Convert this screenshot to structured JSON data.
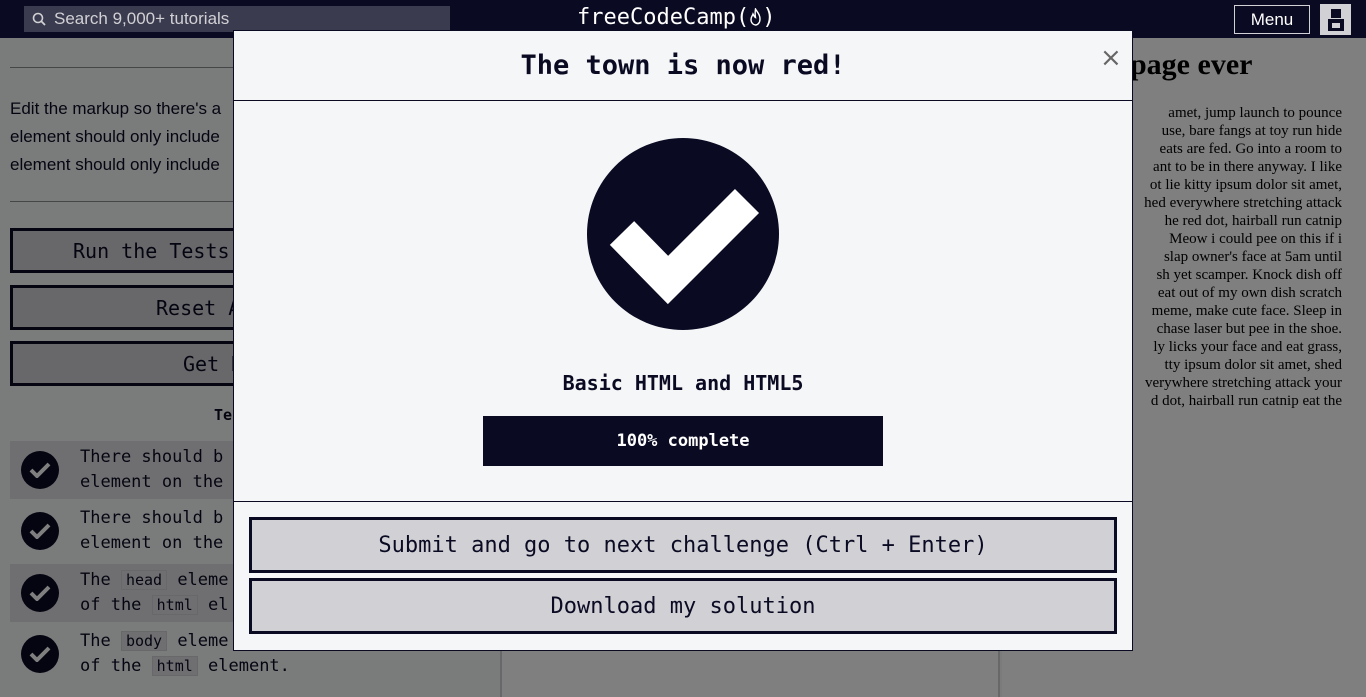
{
  "navbar": {
    "search_placeholder": "Search 9,000+ tutorials",
    "brand": "freeCodeCamp",
    "menu_label": "Menu"
  },
  "challenge": {
    "instructions": [
      "Edit the markup so there's a",
      "element should only include",
      "element should only include"
    ],
    "buttons": {
      "run_tests": "Run the Tests",
      "reset": "Reset A",
      "get_help": "Get H"
    },
    "tests_label": "Te",
    "tests": [
      {
        "line1": "There should b",
        "line2": "element on the"
      },
      {
        "line1": "There should b",
        "line2": "element on the"
      },
      {
        "line1_pre": "The ",
        "line1_code": "head",
        "line1_post": " eleme",
        "line2_pre": "of the ",
        "line2_code": "html",
        "line2_post": " el"
      },
      {
        "line1_pre": "The ",
        "line1_code": "body",
        "line1_post": " eleme",
        "line2_pre": "of the ",
        "line2_code": "html",
        "line2_post": " element."
      }
    ]
  },
  "preview": {
    "heading": "page ever",
    "lorem_lines": [
      "amet, jump launch to pounce",
      "use, bare fangs at toy run hide",
      "eats are fed. Go into a room to",
      "ant to be in there anyway. I like",
      "ot lie kitty ipsum dolor sit amet,",
      "hed everywhere stretching attack",
      "he red dot, hairball run catnip",
      "Meow i could pee on this if i",
      "slap owner's face at 5am until",
      "sh yet scamper. Knock dish off",
      "eat out of my own dish scratch",
      "meme, make cute face. Sleep in",
      "chase laser but pee in the shoe.",
      "ly licks your face and eat grass,",
      "tty ipsum dolor sit amet, shed",
      "verywhere stretching attack your",
      "d dot, hairball run catnip eat the"
    ]
  },
  "modal": {
    "title": "The town is now red!",
    "close_symbol": "×",
    "certification": "Basic HTML and HTML5",
    "progress_percent": 100,
    "progress_label": "100% complete",
    "submit_label": "Submit and go to next challenge (Ctrl + Enter)",
    "download_label": "Download my solution"
  },
  "colors": {
    "dark": "#0a0a23",
    "button_bg": "#d0d0d5",
    "modal_bg": "#f5f6f7"
  }
}
